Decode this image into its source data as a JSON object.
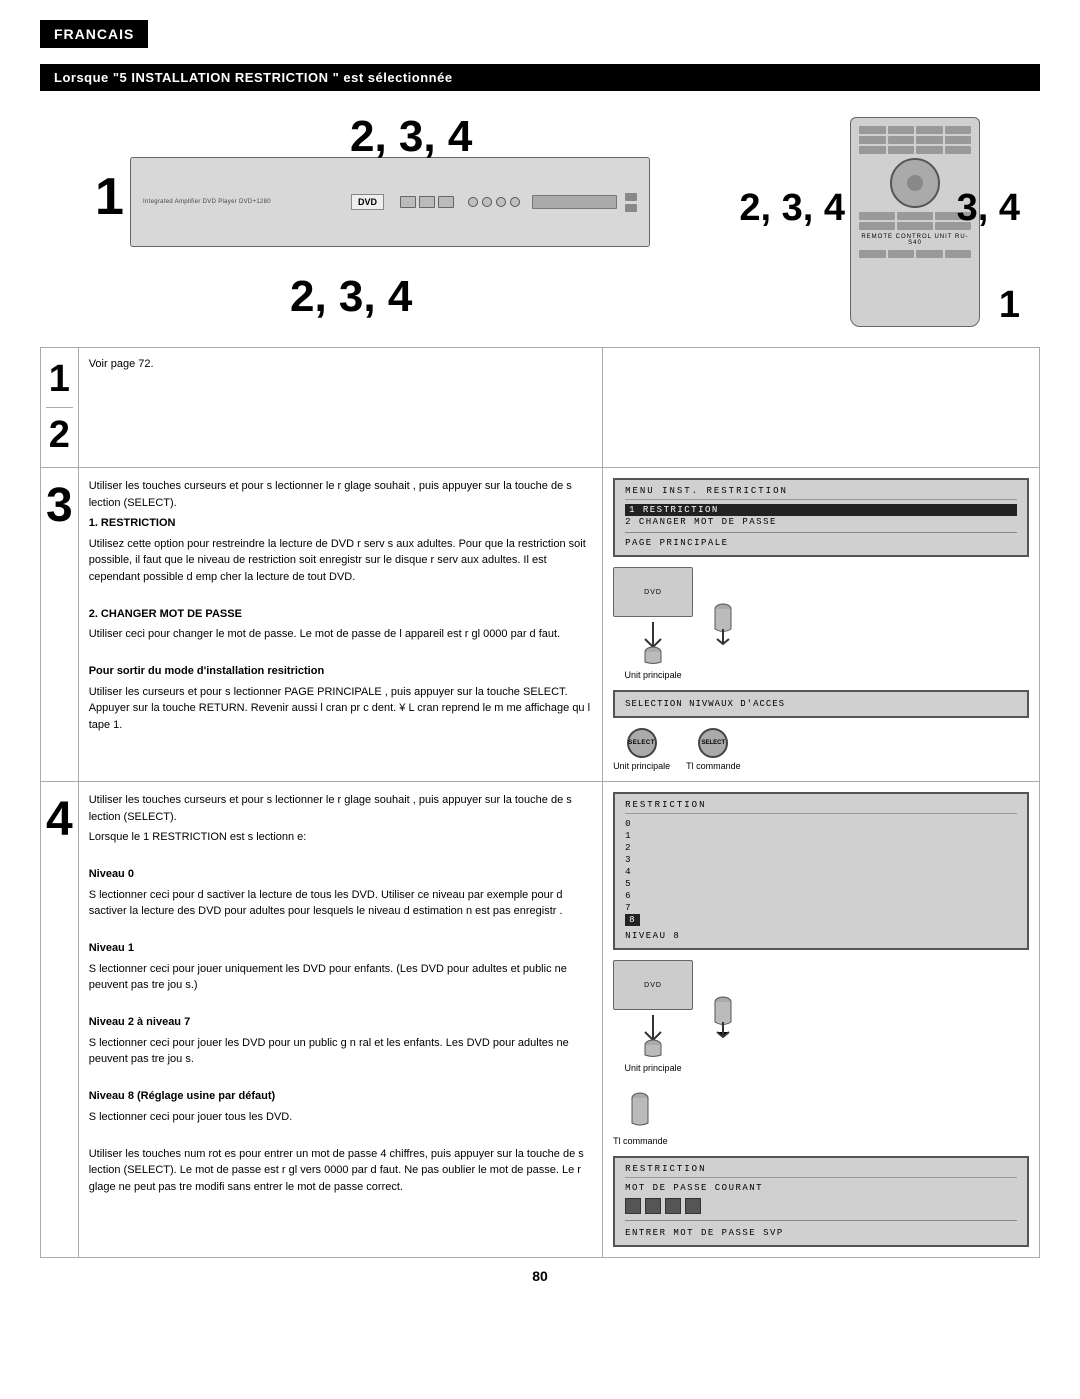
{
  "page": {
    "language": "FRANCAIS",
    "section_title": "Lorsque \"5 INSTALLATION RESTRICTION \" est sélectionnée",
    "page_number": "80"
  },
  "numbers": {
    "n1": "1",
    "n2": "2, 3, 4",
    "n3": "2, 3, 4",
    "n4": "3, 4",
    "n5": "2, 3, 4",
    "n6": "1"
  },
  "steps": {
    "step1_2": {
      "step_label": "1\n2",
      "text": "Voir page 72."
    },
    "step3": {
      "step_label": "3",
      "text_intro": "Utiliser les touches curseurs   et    pour s lectionner le r glage souhait , puis appuyer sur la touche de s lection (SELECT).",
      "item1_label": "1. RESTRICTION",
      "item1_text": "Utilisez cette option pour restreindre la lecture de DVD r serv s aux adultes. Pour que la restriction soit possible, il faut que le niveau de restriction soit enregistr  sur le disque r serv  aux adultes. Il est cependant possible d emp cher la lecture de tout DVD.",
      "item2_label": "2. CHANGER MOT DE PASSE",
      "item2_text": "Utiliser ceci pour changer le mot de passe. Le mot de passe de l appareil est r gl   0000 par d faut.",
      "exit_label": "Pour sortir du mode d'installation resitriction",
      "exit_text": "Utiliser les curseurs   et   pour s lectionner PAGE PRINCIPALE , puis appuyer sur la touche SELECT. Appuyer sur la touche RETURN. Revenir aussi l cran pr c dent. ¥ L cran reprend le m me affichage qu  l tape  1."
    },
    "step4_top": {
      "step_label": "4",
      "text_intro": "Utiliser les touches curseurs   et    pour s lectionner le r glage souhait , puis appuyer sur la touche de s lection (SELECT).",
      "lorsque": "Lorsque le  1 RESTRICTION est s lectionn e:",
      "niveau0_label": "Niveau 0",
      "niveau0_text": "S lectionner ceci pour d sactiver la lecture de tous les DVD. Utiliser ce niveau par exemple pour d sactiver la lecture des DVD pour adultes pour lesquels le niveau d estimation n est pas enregistr .",
      "niveau1_label": "Niveau 1",
      "niveau1_text": "S lectionner ceci pour jouer uniquement les DVD pour enfants. (Les DVD pour adultes et public ne peuvent pas  tre jou s.)",
      "niveau27_label": "Niveau 2 à niveau 7",
      "niveau27_text": "S lectionner ceci pour jouer les DVD pour un public g n ral et les enfants. Les DVD pour adultes ne peuvent pas  tre jou s.",
      "niveau8_label": "Niveau 8 (Réglage usine par défaut)",
      "niveau8_text": "S lectionner ceci pour jouer tous les DVD."
    },
    "step4_bottom": {
      "text": "Utiliser les touches num rot es pour entrer un mot de passe  4 chiffres, puis appuyer sur la touche de s lection (SELECT). Le mot de passe est r gl  vers  0000 par d faut. Ne pas oublier le mot de passe. Le r glage ne peut pas  tre modifi  sans entrer le mot de passe correct."
    }
  },
  "osd": {
    "menu_restriction": {
      "title": "MENU  INST. RESTRICTION",
      "item1": "1  RESTRICTION",
      "item2": "2  CHANGER MOT DE PASSE",
      "divider": true,
      "item3": "PAGE PRINCIPALE"
    },
    "selection_niveaux": {
      "label": "SELECTION NIVWAUX D'ACCES"
    },
    "restriction_levels": {
      "title": "RESTRICTION",
      "levels": [
        "0",
        "1",
        "2",
        "3",
        "4",
        "5",
        "6",
        "7",
        "8"
      ],
      "highlighted": "8",
      "label": "NIVEAU 8"
    },
    "restriction_password": {
      "title": "RESTRICTION",
      "label": "MOT DE PASSE COURANT",
      "prompt": "ENTRER MOT DE PASSE SVP"
    }
  },
  "labels": {
    "unite_principale": "Unit principale",
    "telecommande": "Tl commande",
    "select_btn": "SELECT"
  },
  "restriction_veau": {
    "line1": "RESTRICT ION",
    "line2": "VEAU"
  }
}
